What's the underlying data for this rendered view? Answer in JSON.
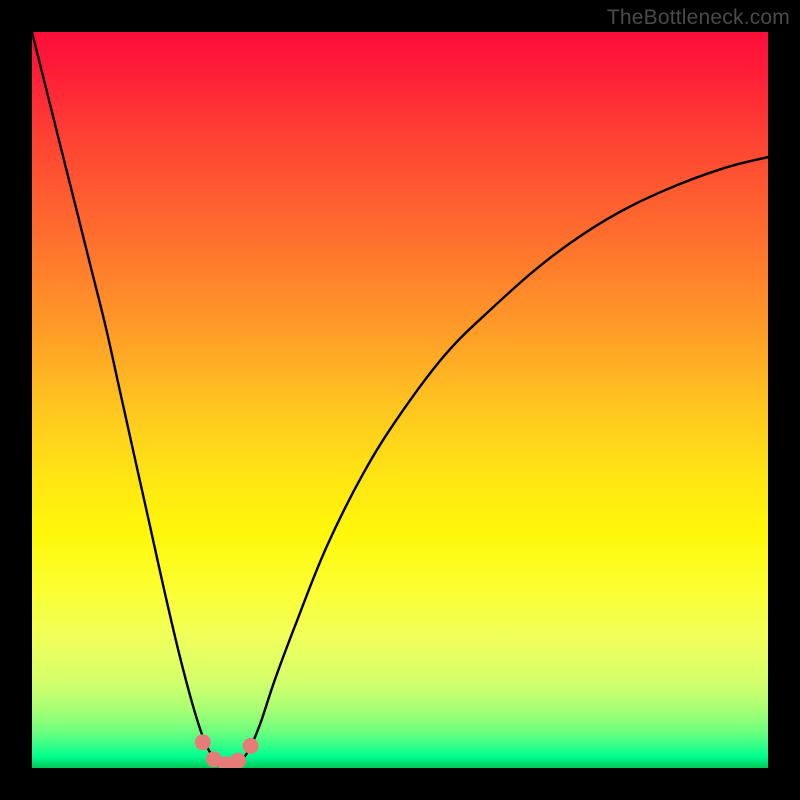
{
  "watermark": "TheBottleneck.com",
  "colors": {
    "frame": "#000000",
    "curve": "#000000",
    "marker_fill": "#e77b78",
    "marker_stroke": "#c85a58",
    "gradient_top": "#ff0e3a",
    "gradient_bottom": "#00c853"
  },
  "chart_data": {
    "type": "line",
    "title": "",
    "xlabel": "",
    "ylabel": "",
    "x_range_fraction": [
      0,
      1
    ],
    "y_range_percent": [
      0,
      100
    ],
    "series": [
      {
        "name": "bottleneck-curve",
        "x_fraction": [
          0.0,
          0.02,
          0.04,
          0.06,
          0.08,
          0.1,
          0.12,
          0.14,
          0.16,
          0.18,
          0.2,
          0.22,
          0.235,
          0.25,
          0.265,
          0.28,
          0.295,
          0.31,
          0.33,
          0.36,
          0.4,
          0.45,
          0.5,
          0.56,
          0.62,
          0.7,
          0.78,
          0.86,
          0.94,
          1.0
        ],
        "y_percent": [
          100.0,
          92.0,
          84.0,
          76.0,
          68.0,
          60.0,
          51.0,
          42.0,
          33.0,
          24.0,
          15.5,
          8.0,
          3.5,
          1.0,
          0.3,
          0.6,
          2.5,
          6.0,
          12.0,
          20.0,
          30.0,
          40.0,
          48.0,
          56.0,
          62.0,
          69.0,
          74.5,
          78.5,
          81.5,
          83.0
        ]
      }
    ],
    "markers": {
      "name": "highlight-dots",
      "x_fraction": [
        0.232,
        0.247,
        0.264,
        0.28,
        0.297
      ],
      "y_percent": [
        3.5,
        1.2,
        0.5,
        1.0,
        3.0
      ]
    },
    "notes": "Values estimated from pixels; x is normalized 0–1 across plot width, y is bottleneck percentage 0–100 (0 at bottom)."
  }
}
